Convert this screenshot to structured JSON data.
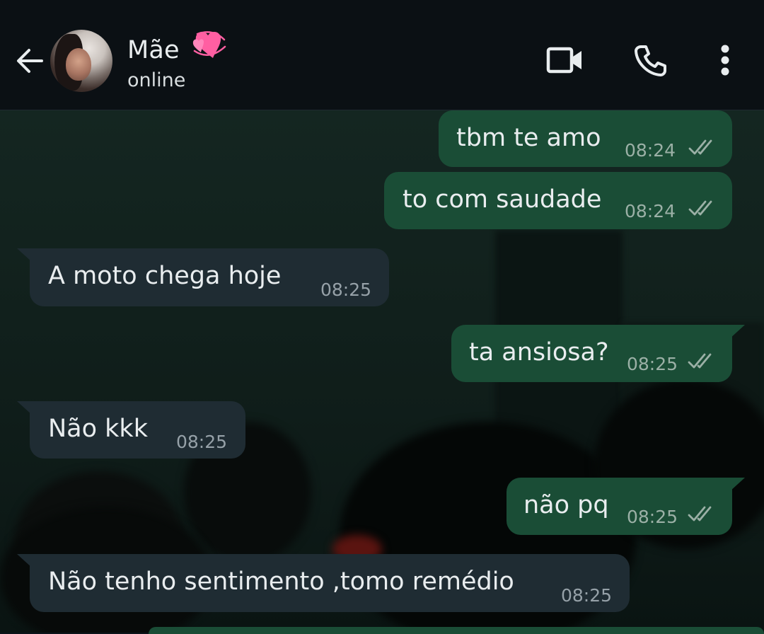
{
  "header": {
    "contact_name": "Mãe",
    "contact_status": "online",
    "name_emoji": "two-hearts-emoji"
  },
  "messages": [
    {
      "direction": "outgoing",
      "text": "tbm te amo",
      "time": "08:24",
      "status": "read-double-check"
    },
    {
      "direction": "outgoing",
      "text": "to com saudade",
      "time": "08:24",
      "status": "read-double-check"
    },
    {
      "direction": "incoming",
      "text": "A moto chega hoje",
      "time": "08:25"
    },
    {
      "direction": "outgoing",
      "text": "ta ansiosa?",
      "time": "08:25",
      "status": "read-double-check"
    },
    {
      "direction": "incoming",
      "text": "Não kkk",
      "time": "08:25"
    },
    {
      "direction": "outgoing",
      "text": "não pq",
      "time": "08:25",
      "status": "read-double-check"
    },
    {
      "direction": "incoming",
      "text": "Não tenho sentimento ,tomo remédio",
      "time": "08:25"
    }
  ],
  "icons": {
    "back": "arrow-left-icon",
    "video": "video-camera-icon",
    "call": "phone-icon",
    "menu": "more-vertical-icon"
  },
  "colors": {
    "header_bg": "#0b1014",
    "outgoing_bubble": "#1a4d36",
    "incoming_bubble": "#1f2c33",
    "text": "#e9edef"
  }
}
